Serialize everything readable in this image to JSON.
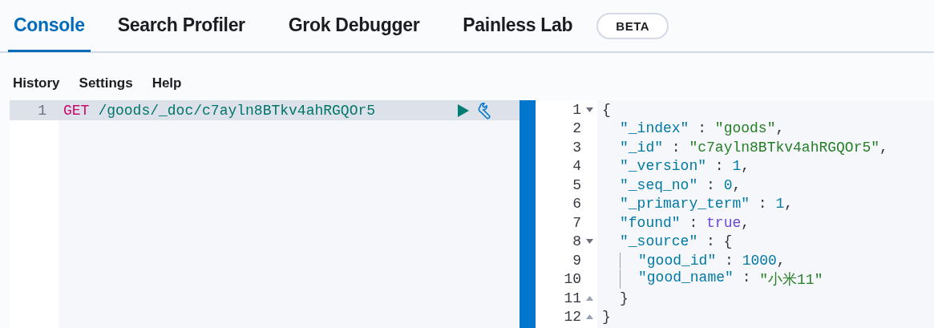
{
  "tabs": [
    {
      "label": "Console",
      "selected": true
    },
    {
      "label": "Search Profiler",
      "selected": false
    },
    {
      "label": "Grok Debugger",
      "selected": false
    },
    {
      "label": "Painless Lab",
      "selected": false,
      "badge": "BETA"
    }
  ],
  "menu": [
    "History",
    "Settings",
    "Help"
  ],
  "request": {
    "lines": [
      {
        "number": "1",
        "active": true,
        "tokens": [
          {
            "kind": "method",
            "text": "GET"
          },
          {
            "kind": "path",
            "text": "/goods/_doc/c7ayln8BTkv4ahRGQOr5"
          }
        ]
      }
    ]
  },
  "response": {
    "lines": [
      {
        "number": "1",
        "kind": "fold_start",
        "tokens": [
          {
            "kind": "punct",
            "text": "{"
          }
        ],
        "children": [
          {
            "number": "2",
            "tokens": [
              {
                "kind": "key",
                "text": "\"_index\""
              },
              {
                "kind": "punct",
                "text": " : "
              },
              {
                "kind": "string",
                "text": "\"goods\""
              },
              {
                "kind": "punct",
                "text": ","
              }
            ]
          },
          {
            "number": "3",
            "tokens": [
              {
                "kind": "key",
                "text": "\"_id\""
              },
              {
                "kind": "punct",
                "text": " : "
              },
              {
                "kind": "string",
                "text": "\"c7ayln8BTkv4ahRGQOr5\""
              },
              {
                "kind": "punct",
                "text": ","
              }
            ]
          },
          {
            "number": "4",
            "tokens": [
              {
                "kind": "key",
                "text": "\"_version\""
              },
              {
                "kind": "punct",
                "text": " : "
              },
              {
                "kind": "number",
                "text": "1"
              },
              {
                "kind": "punct",
                "text": ","
              }
            ]
          },
          {
            "number": "5",
            "tokens": [
              {
                "kind": "key",
                "text": "\"_seq_no\""
              },
              {
                "kind": "punct",
                "text": " : "
              },
              {
                "kind": "number",
                "text": "0"
              },
              {
                "kind": "punct",
                "text": ","
              }
            ]
          },
          {
            "number": "6",
            "tokens": [
              {
                "kind": "key",
                "text": "\"_primary_term\""
              },
              {
                "kind": "punct",
                "text": " : "
              },
              {
                "kind": "number",
                "text": "1"
              },
              {
                "kind": "punct",
                "text": ","
              }
            ]
          },
          {
            "number": "7",
            "tokens": [
              {
                "kind": "key",
                "text": "\"found\""
              },
              {
                "kind": "punct",
                "text": " : "
              },
              {
                "kind": "bool",
                "text": "true"
              },
              {
                "kind": "punct",
                "text": ","
              }
            ]
          },
          {
            "number": "8",
            "kind": "fold_start",
            "tokens": [
              {
                "kind": "key",
                "text": "\"_source\""
              },
              {
                "kind": "punct",
                "text": " : {"
              }
            ],
            "children": [
              {
                "number": "9",
                "tokens": [
                  {
                    "kind": "key",
                    "text": "\"good_id\""
                  },
                  {
                    "kind": "punct",
                    "text": " : "
                  },
                  {
                    "kind": "number",
                    "text": "1000"
                  },
                  {
                    "kind": "punct",
                    "text": ","
                  }
                ]
              },
              {
                "number": "10",
                "tokens": [
                  {
                    "kind": "key",
                    "text": "\"good_name\""
                  },
                  {
                    "kind": "punct",
                    "text": " : "
                  },
                  {
                    "kind": "string",
                    "text": "\"小米11\""
                  }
                ]
              }
            ]
          },
          {
            "number": "11",
            "kind": "fold_end",
            "tokens": [
              {
                "kind": "punct",
                "text": "}"
              }
            ]
          }
        ]
      },
      {
        "number": "12",
        "kind": "fold_end",
        "tokens": [
          {
            "kind": "punct",
            "text": "}"
          }
        ]
      }
    ]
  }
}
